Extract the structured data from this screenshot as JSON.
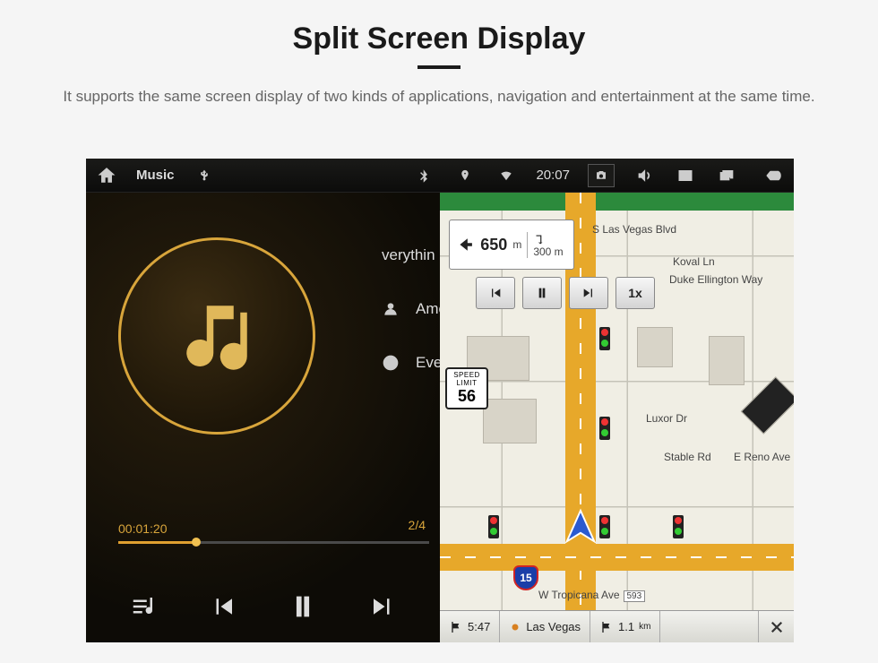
{
  "heading": {
    "title": "Split Screen Display",
    "subtitle": "It supports the same screen display of two kinds of applications, navigation and entertainment at the same time."
  },
  "statusbar": {
    "app_label": "Music",
    "time": "20:07",
    "icons": {
      "home": "home-icon",
      "usb": "usb-icon",
      "bluetooth": "bluetooth-icon",
      "location": "location-icon",
      "wifi": "wifi-icon",
      "camera": "camera-icon",
      "volume": "volume-icon",
      "close": "close-screen-icon",
      "recent": "recent-apps-icon",
      "back": "back-icon"
    }
  },
  "music": {
    "track_rows": [
      {
        "icon": "equalizer",
        "label": "verythin"
      },
      {
        "icon": "artist",
        "label": "Ame"
      },
      {
        "icon": "album",
        "label": "Ever"
      }
    ],
    "elapsed": "00:01:20",
    "counter": "2/4",
    "controls": {
      "playlist": "playlist-icon",
      "prev": "prev-track-icon",
      "pause": "pause-icon",
      "next": "next-track-icon"
    }
  },
  "map": {
    "turn": {
      "distance": "650",
      "distance_unit": "m",
      "sub": "300 m"
    },
    "speed_limit": {
      "label": "SPEED LIMIT",
      "value": "56"
    },
    "interstate": "15",
    "streets": {
      "top": "S Las Vegas Blvd",
      "r1": "Koval Ln",
      "r2": "Duke Ellington Way",
      "r3": "Luxor Dr",
      "r4_a": "Stable Rd",
      "r4_b": "E Reno Ave",
      "bottom": "W Tropicana Ave",
      "bottom_badge": "593"
    },
    "nav_media": {
      "prev": "prev-icon",
      "pause": "pause-icon",
      "next": "next-icon",
      "speed": "1x"
    },
    "footer": {
      "eta": "5:47",
      "leg1": "Las Vegas",
      "leg1_icon": "flag-icon",
      "leg2": "1.1",
      "leg2_unit": "km",
      "close": "close-icon"
    }
  }
}
